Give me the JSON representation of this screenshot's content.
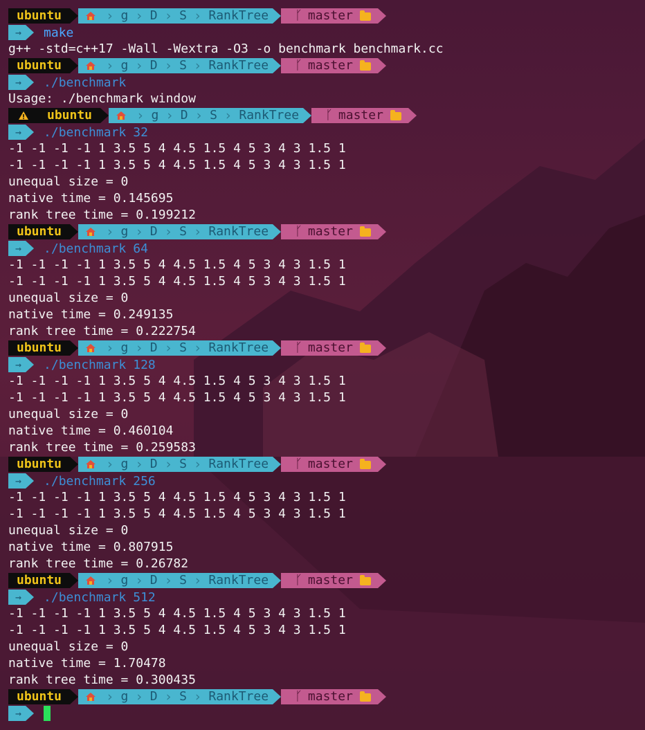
{
  "prompt": {
    "user": "ubuntu",
    "path": [
      "g",
      "D",
      "S",
      "RankTree"
    ],
    "branch": "master",
    "command_arrow": "→"
  },
  "colors": {
    "background": "#5a1d3a",
    "user_bg": "#0d0d0d",
    "user_fg": "#f0c419",
    "path_bg": "#49b6cf",
    "git_bg": "#c35a8f",
    "command_fg": "#3d8fd6",
    "cursor": "#2ae05a"
  },
  "icons": [
    "home-icon",
    "git-branch-icon",
    "folder-icon",
    "warning-icon",
    "arrow-icon"
  ],
  "commands": {
    "c1": "make",
    "c2": "./benchmark",
    "c3": "./benchmark",
    "a3": "32",
    "c4": "./benchmark",
    "a4": "64",
    "c5": "./benchmark",
    "a5": "128",
    "c6": "./benchmark",
    "a6": "256",
    "c7": "./benchmark",
    "a7": "512"
  },
  "output": {
    "make": "g++ -std=c++17 -Wall -Wextra -O3 -o benchmark benchmark.cc",
    "usage": "Usage: ./benchmark window",
    "r32": [
      "-1 -1 -1 -1 1 3.5 5 4 4.5 1.5 4 5 3 4 3 1.5 1",
      "-1 -1 -1 -1 1 3.5 5 4 4.5 1.5 4 5 3 4 3 1.5 1",
      "unequal size = 0",
      "native time = 0.145695",
      "rank tree time = 0.199212"
    ],
    "r64": [
      "-1 -1 -1 -1 1 3.5 5 4 4.5 1.5 4 5 3 4 3 1.5 1",
      "-1 -1 -1 -1 1 3.5 5 4 4.5 1.5 4 5 3 4 3 1.5 1",
      "unequal size = 0",
      "native time = 0.249135",
      "rank tree time = 0.222754"
    ],
    "r128": [
      "-1 -1 -1 -1 1 3.5 5 4 4.5 1.5 4 5 3 4 3 1.5 1",
      "-1 -1 -1 -1 1 3.5 5 4 4.5 1.5 4 5 3 4 3 1.5 1",
      "unequal size = 0",
      "native time = 0.460104",
      "rank tree time = 0.259583"
    ],
    "r256": [
      "-1 -1 -1 -1 1 3.5 5 4 4.5 1.5 4 5 3 4 3 1.5 1",
      "-1 -1 -1 -1 1 3.5 5 4 4.5 1.5 4 5 3 4 3 1.5 1",
      "unequal size = 0",
      "native time = 0.807915",
      "rank tree time = 0.26782"
    ],
    "r512": [
      "-1 -1 -1 -1 1 3.5 5 4 4.5 1.5 4 5 3 4 3 1.5 1",
      "-1 -1 -1 -1 1 3.5 5 4 4.5 1.5 4 5 3 4 3 1.5 1",
      "unequal size = 0",
      "native time = 1.70478",
      "rank tree time = 0.300435"
    ]
  }
}
